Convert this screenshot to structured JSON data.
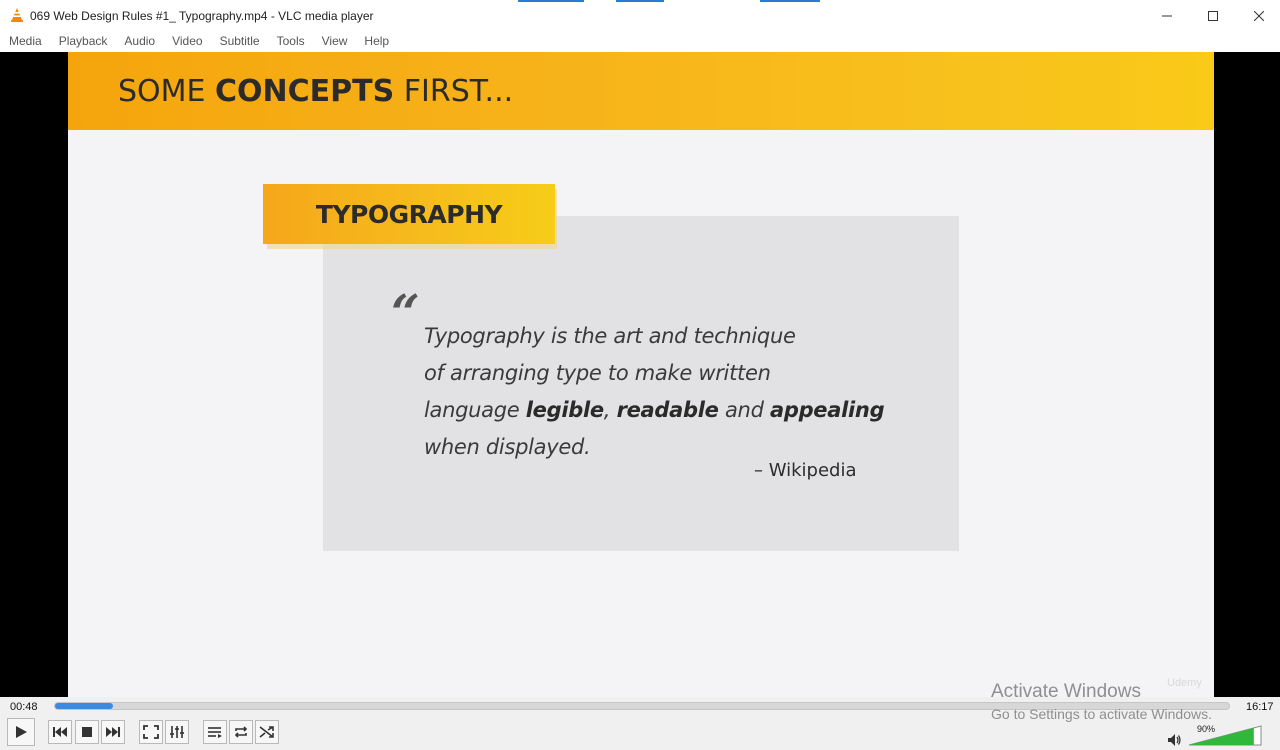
{
  "window": {
    "title": "069 Web Design Rules #1_ Typography.mp4 - VLC media player",
    "minimize_symbol": "—",
    "maximize_symbol": "☐",
    "close_symbol": "✕"
  },
  "menu": [
    "Media",
    "Playback",
    "Audio",
    "Video",
    "Subtitle",
    "Tools",
    "View",
    "Help"
  ],
  "slide": {
    "heading_pre": "SOME ",
    "heading_bold": "CONCEPTS",
    "heading_post": " FIRST...",
    "tag_label": "TYPOGRAPHY",
    "quote_mark": "“",
    "quote_line1": "Typography is the art and technique",
    "quote_line2": "of arranging type to make written",
    "quote_line3_pre": "language ",
    "quote_line3_b1": "legible",
    "quote_line3_mid1": ", ",
    "quote_line3_b2": "readable",
    "quote_line3_mid2": " and ",
    "quote_line3_b3": "appealing",
    "quote_line4": "when displayed.",
    "source": "– Wikipedia",
    "watermark": "Udemy",
    "header_gradient": [
      "#f5a50c",
      "#f9ca18"
    ]
  },
  "player": {
    "elapsed": "00:48",
    "total": "16:17",
    "progress_fraction": 0.049,
    "volume_label": "90%",
    "volume_fraction": 0.9,
    "accent_color": "#3b8ae0",
    "volume_color": "#2fb83a"
  },
  "overlay": {
    "activate_title": "Activate Windows",
    "activate_sub": "Go to Settings to activate Windows."
  },
  "icons": {
    "app": "vlc-cone-icon",
    "play": "play-icon",
    "prev": "previous-icon",
    "stop": "stop-icon",
    "next": "next-icon",
    "fullscreen": "fullscreen-icon",
    "settings": "equalizer-icon",
    "playlist": "playlist-icon",
    "loop": "loop-icon",
    "shuffle": "shuffle-icon",
    "speaker": "speaker-icon"
  }
}
